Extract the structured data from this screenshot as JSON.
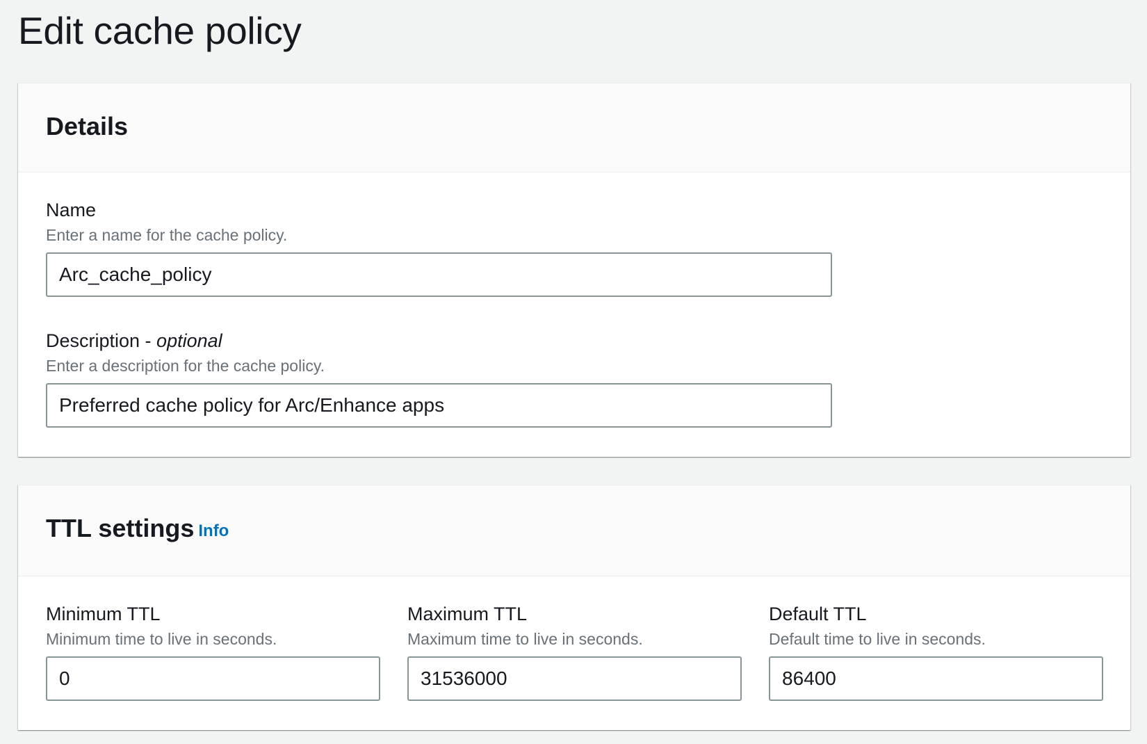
{
  "page": {
    "title": "Edit cache policy"
  },
  "details": {
    "heading": "Details",
    "name": {
      "label": "Name",
      "hint": "Enter a name for the cache policy.",
      "value": "Arc_cache_policy"
    },
    "description": {
      "label": "Description - ",
      "label_optional": "optional",
      "hint": "Enter a description for the cache policy.",
      "value": "Preferred cache policy for Arc/Enhance apps"
    }
  },
  "ttl": {
    "heading": "TTL settings",
    "info_link": "Info",
    "minimum": {
      "label": "Minimum TTL",
      "hint": "Minimum time to live in seconds.",
      "value": "0"
    },
    "maximum": {
      "label": "Maximum TTL",
      "hint": "Maximum time to live in seconds.",
      "value": "31536000"
    },
    "default": {
      "label": "Default TTL",
      "hint": "Default time to live in seconds.",
      "value": "86400"
    }
  },
  "colors": {
    "background": "#f2f3f3",
    "panel": "#ffffff",
    "panel_header": "#fafafa",
    "text": "#16191f",
    "hint_text": "#687078",
    "link": "#0073bb",
    "input_border": "#879596"
  }
}
